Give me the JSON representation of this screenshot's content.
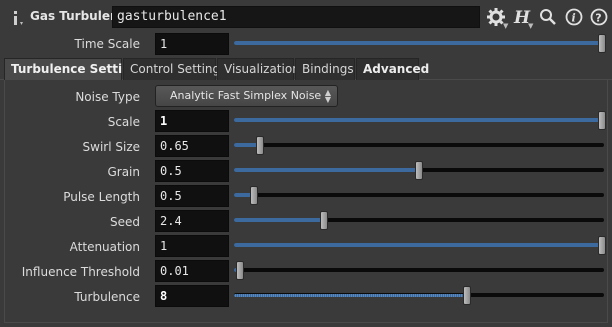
{
  "header": {
    "node_type": "Gas Turbulence",
    "node_name": "gasturbulence1",
    "icons": [
      "info-icon",
      "gear-icon",
      "houdini-help-icon",
      "search-icon",
      "info-circle-icon",
      "help-icon"
    ]
  },
  "time_scale": {
    "label": "Time Scale",
    "value": "1",
    "slider_fraction": 1.0
  },
  "tabs": [
    {
      "label": "Turbulence Settings",
      "active": true
    },
    {
      "label": "Control Settings",
      "active": false
    },
    {
      "label": "Visualization",
      "active": false
    },
    {
      "label": "Bindings",
      "active": false
    },
    {
      "label": "Advanced",
      "active": false
    }
  ],
  "noise_type": {
    "label": "Noise Type",
    "value": "Analytic Fast Simplex Noise"
  },
  "params": [
    {
      "label": "Scale",
      "value": "1",
      "slider_fraction": 1.0
    },
    {
      "label": "Swirl Size",
      "value": "0.65",
      "slider_fraction": 0.065
    },
    {
      "label": "Grain",
      "value": "0.5",
      "slider_fraction": 0.5
    },
    {
      "label": "Pulse Length",
      "value": "0.5",
      "slider_fraction": 0.05
    },
    {
      "label": "Seed",
      "value": "2.4",
      "slider_fraction": 0.24
    },
    {
      "label": "Attenuation",
      "value": "1",
      "slider_fraction": 1.0
    },
    {
      "label": "Influence Threshold",
      "value": "0.01",
      "slider_fraction": 0.01
    },
    {
      "label": "Turbulence",
      "value": "8",
      "slider_fraction": 0.63
    }
  ],
  "colors": {
    "background": "#3a3a3a",
    "field": "#101010",
    "slider_fill": "#3d6a9e",
    "handle": "#a8a8a8"
  }
}
